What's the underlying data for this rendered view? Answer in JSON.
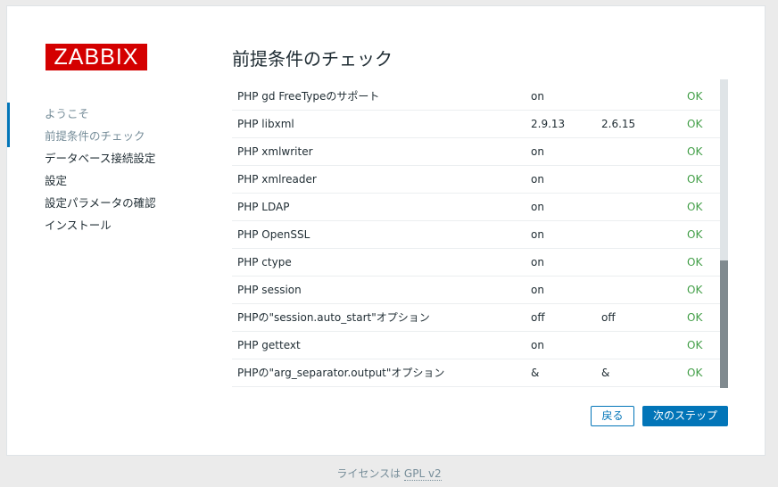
{
  "logo": "ZABBIX",
  "steps": [
    {
      "label": "ようこそ"
    },
    {
      "label": "前提条件のチェック"
    },
    {
      "label": "データベース接続設定"
    },
    {
      "label": "設定"
    },
    {
      "label": "設定パラメータの確認"
    },
    {
      "label": "インストール"
    }
  ],
  "page_title": "前提条件のチェック",
  "rows": [
    {
      "name": "PHP gd FreeTypeのサポート",
      "current": "on",
      "required": "",
      "result": "OK"
    },
    {
      "name": "PHP libxml",
      "current": "2.9.13",
      "required": "2.6.15",
      "result": "OK"
    },
    {
      "name": "PHP xmlwriter",
      "current": "on",
      "required": "",
      "result": "OK"
    },
    {
      "name": "PHP xmlreader",
      "current": "on",
      "required": "",
      "result": "OK"
    },
    {
      "name": "PHP LDAP",
      "current": "on",
      "required": "",
      "result": "OK"
    },
    {
      "name": "PHP OpenSSL",
      "current": "on",
      "required": "",
      "result": "OK"
    },
    {
      "name": "PHP ctype",
      "current": "on",
      "required": "",
      "result": "OK"
    },
    {
      "name": "PHP session",
      "current": "on",
      "required": "",
      "result": "OK"
    },
    {
      "name": "PHPの\"session.auto_start\"オプション",
      "current": "off",
      "required": "off",
      "result": "OK"
    },
    {
      "name": "PHP gettext",
      "current": "on",
      "required": "",
      "result": "OK"
    },
    {
      "name": "PHPの\"arg_separator.output\"オプション",
      "current": "&",
      "required": "&",
      "result": "OK"
    }
  ],
  "buttons": {
    "back": "戻る",
    "next": "次のステップ"
  },
  "footer": {
    "text": "ライセンスは",
    "link": "GPL v2"
  },
  "colors": {
    "accent": "#0275b8",
    "ok": "#429e47",
    "logo": "#d40000"
  }
}
